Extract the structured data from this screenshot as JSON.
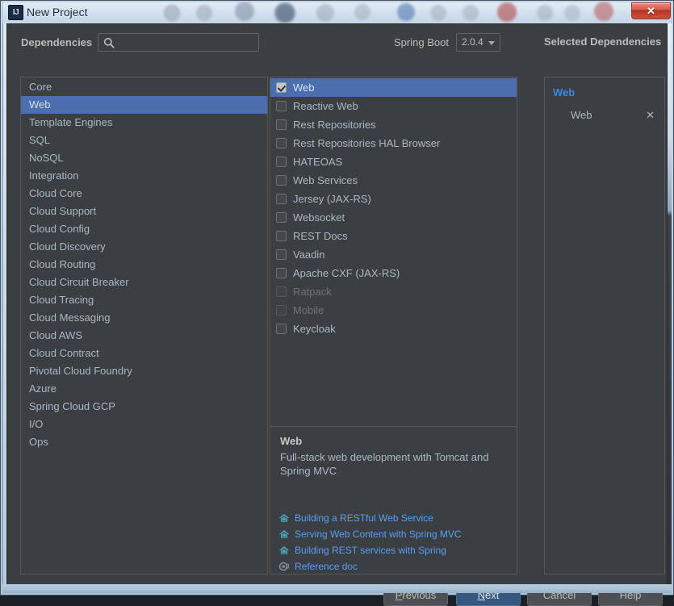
{
  "window": {
    "title": "New Project",
    "app_icon": "IJ",
    "close_label": "✕"
  },
  "header": {
    "dependencies_label": "Dependencies",
    "search_placeholder": "",
    "search_value": "",
    "search_icon": "search-icon",
    "spring_boot_label": "Spring Boot",
    "spring_boot_version": "2.0.4",
    "selected_dependencies_title": "Selected Dependencies"
  },
  "categories": [
    {
      "label": "Core",
      "selected": false
    },
    {
      "label": "Web",
      "selected": true
    },
    {
      "label": "Template Engines",
      "selected": false
    },
    {
      "label": "SQL",
      "selected": false
    },
    {
      "label": "NoSQL",
      "selected": false
    },
    {
      "label": "Integration",
      "selected": false
    },
    {
      "label": "Cloud Core",
      "selected": false
    },
    {
      "label": "Cloud Support",
      "selected": false
    },
    {
      "label": "Cloud Config",
      "selected": false
    },
    {
      "label": "Cloud Discovery",
      "selected": false
    },
    {
      "label": "Cloud Routing",
      "selected": false
    },
    {
      "label": "Cloud Circuit Breaker",
      "selected": false
    },
    {
      "label": "Cloud Tracing",
      "selected": false
    },
    {
      "label": "Cloud Messaging",
      "selected": false
    },
    {
      "label": "Cloud AWS",
      "selected": false
    },
    {
      "label": "Cloud Contract",
      "selected": false
    },
    {
      "label": "Pivotal Cloud Foundry",
      "selected": false
    },
    {
      "label": "Azure",
      "selected": false
    },
    {
      "label": "Spring Cloud GCP",
      "selected": false
    },
    {
      "label": "I/O",
      "selected": false
    },
    {
      "label": "Ops",
      "selected": false
    }
  ],
  "options": [
    {
      "label": "Web",
      "checked": true,
      "selected": true,
      "disabled": false
    },
    {
      "label": "Reactive Web",
      "checked": false,
      "selected": false,
      "disabled": false
    },
    {
      "label": "Rest Repositories",
      "checked": false,
      "selected": false,
      "disabled": false
    },
    {
      "label": "Rest Repositories HAL Browser",
      "checked": false,
      "selected": false,
      "disabled": false
    },
    {
      "label": "HATEOAS",
      "checked": false,
      "selected": false,
      "disabled": false
    },
    {
      "label": "Web Services",
      "checked": false,
      "selected": false,
      "disabled": false
    },
    {
      "label": "Jersey (JAX-RS)",
      "checked": false,
      "selected": false,
      "disabled": false
    },
    {
      "label": "Websocket",
      "checked": false,
      "selected": false,
      "disabled": false
    },
    {
      "label": "REST Docs",
      "checked": false,
      "selected": false,
      "disabled": false
    },
    {
      "label": "Vaadin",
      "checked": false,
      "selected": false,
      "disabled": false
    },
    {
      "label": "Apache CXF (JAX-RS)",
      "checked": false,
      "selected": false,
      "disabled": false
    },
    {
      "label": "Ratpack",
      "checked": false,
      "selected": false,
      "disabled": true
    },
    {
      "label": "Mobile",
      "checked": false,
      "selected": false,
      "disabled": true
    },
    {
      "label": "Keycloak",
      "checked": false,
      "selected": false,
      "disabled": false
    }
  ],
  "info": {
    "title": "Web",
    "description": "Full-stack web development with Tomcat and Spring MVC",
    "links": [
      {
        "text": "Building a RESTful Web Service",
        "icon": "guide-home-icon"
      },
      {
        "text": "Serving Web Content with Spring MVC",
        "icon": "guide-home-icon"
      },
      {
        "text": "Building REST services with Spring",
        "icon": "guide-home-icon"
      },
      {
        "text": "Reference doc",
        "icon": "reference-doc-icon"
      }
    ]
  },
  "selected_dependencies": {
    "group_label": "Web",
    "items": [
      {
        "name": "Web",
        "remove_label": "✕"
      }
    ]
  },
  "buttons": {
    "previous": {
      "mnemonic": "P",
      "rest": "revious"
    },
    "next": {
      "mnemonic": "N",
      "rest": "ext"
    },
    "cancel": "Cancel",
    "help": "Help"
  },
  "colors": {
    "accent_selection": "#4b6eaf",
    "link": "#589df6",
    "group_header": "#3a87e8",
    "default_button": "#365880",
    "panel_bg": "#3c3f41",
    "close_button": "#c44434"
  }
}
